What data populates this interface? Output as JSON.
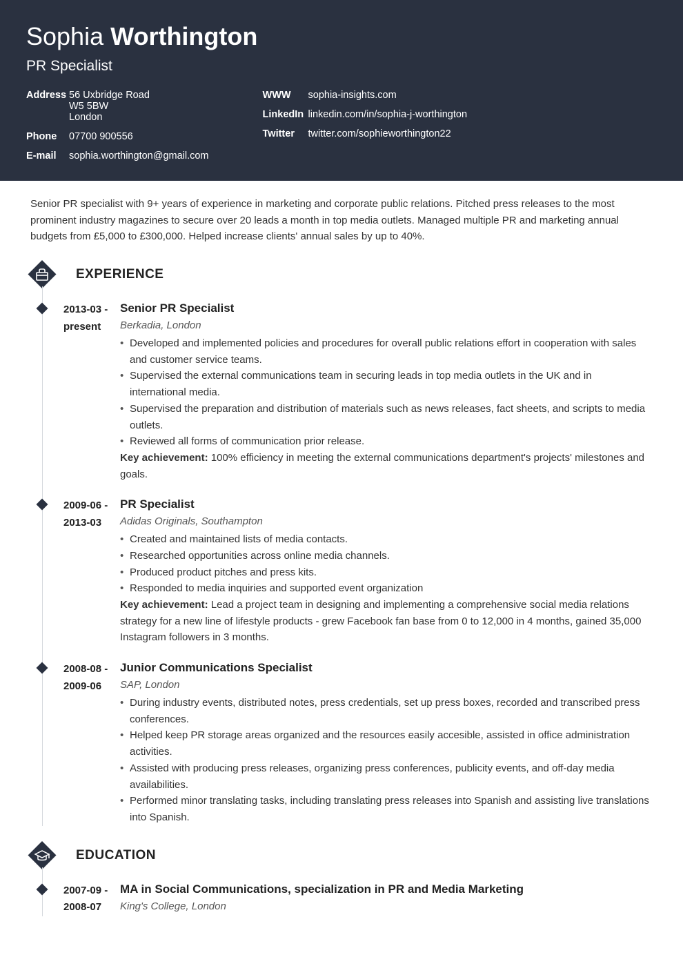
{
  "name": {
    "first": "Sophia",
    "last": "Worthington"
  },
  "role": "PR Specialist",
  "contacts_left": [
    {
      "label": "Address",
      "lines": [
        "56 Uxbridge Road",
        "W5 5BW",
        "London"
      ]
    },
    {
      "label": "Phone",
      "value": "07700 900556"
    },
    {
      "label": "E-mail",
      "value": "sophia.worthington@gmail.com"
    }
  ],
  "contacts_right": [
    {
      "label": "WWW",
      "value": "sophia-insights.com"
    },
    {
      "label": "LinkedIn",
      "value": "linkedin.com/in/sophia-j-worthington"
    },
    {
      "label": "Twitter",
      "value": "twitter.com/sophieworthington22"
    }
  ],
  "summary": "Senior PR specialist with 9+ years of experience in marketing and corporate public relations. Pitched press releases to the most prominent industry magazines to secure over 20 leads a month in top media outlets. Managed multiple PR and marketing annual budgets from £5,000 to £300,000. Helped increase clients' annual sales by up to 40%.",
  "sections": {
    "experience": {
      "title": "EXPERIENCE",
      "entries": [
        {
          "date": "2013-03 - present",
          "title": "Senior PR Specialist",
          "company": "Berkadia, London",
          "bullets": [
            "Developed and implemented policies and procedures for overall public relations effort in cooperation with sales and customer service teams.",
            "Supervised the external communications team in securing leads in top media outlets in the UK and in international media.",
            "Supervised the preparation and distribution of materials such as news releases, fact sheets, and scripts to media outlets.",
            "Reviewed all forms of communication prior release."
          ],
          "achievement_label": "Key achievement:",
          "achievement": "100% efficiency in meeting the external communications department's projects' milestones and goals."
        },
        {
          "date": "2009-06 - 2013-03",
          "title": "PR Specialist",
          "company": "Adidas Originals, Southampton",
          "bullets": [
            "Created and maintained lists of media contacts.",
            "Researched opportunities across online media channels.",
            "Produced product pitches and press kits.",
            "Responded to media inquiries and supported event organization"
          ],
          "achievement_label": "Key achievement:",
          "achievement": "Lead a project team in designing and implementing a comprehensive social media relations strategy for a new line of lifestyle products - grew Facebook fan base from 0 to 12,000 in 4 months, gained 35,000 Instagram followers in 3 months."
        },
        {
          "date": "2008-08 - 2009-06",
          "title": "Junior Communications Specialist",
          "company": "SAP, London",
          "bullets": [
            "During industry events, distributed notes, press credentials, set up press boxes, recorded and transcribed press conferences.",
            "Helped keep PR storage areas organized and the resources easily accesible, assisted in office administration activities.",
            "Assisted with producing press releases, organizing press conferences, publicity events, and off-day media availabilities.",
            "Performed minor translating tasks, including translating press releases into Spanish and assisting live translations into Spanish."
          ]
        }
      ]
    },
    "education": {
      "title": "EDUCATION",
      "entries": [
        {
          "date": "2007-09 - 2008-07",
          "title": "MA in Social Communications, specialization in PR and Media Marketing",
          "company": "King's College, London"
        }
      ]
    }
  }
}
